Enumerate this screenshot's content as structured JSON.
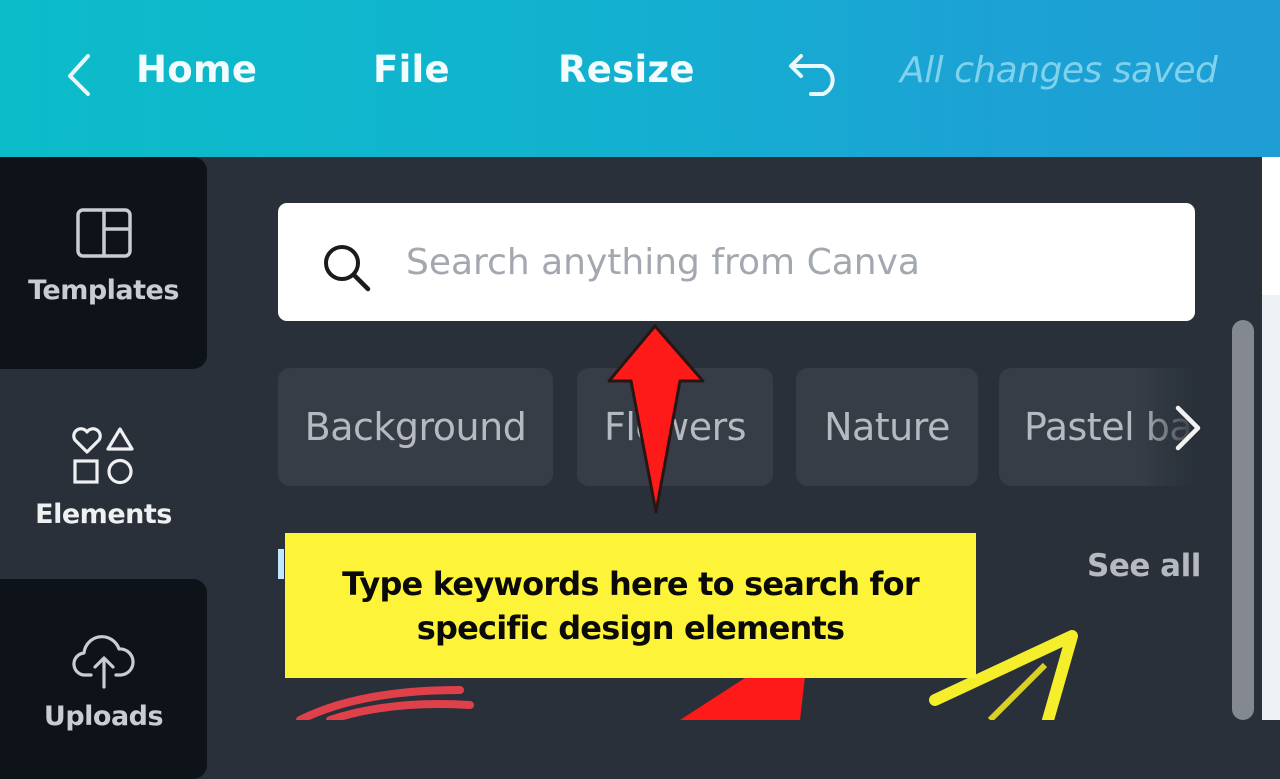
{
  "topbar": {
    "back_icon": "chevron-left-icon",
    "home_label": "Home",
    "file_label": "File",
    "resize_label": "Resize",
    "undo_icon": "undo-icon",
    "save_status": "All changes saved",
    "colors": {
      "gradient_start": "#0cbcc9",
      "gradient_end": "#1f9dd5"
    }
  },
  "sidebar": {
    "items": [
      {
        "label": "Templates",
        "icon": "templates-layout-icon",
        "active": false
      },
      {
        "label": "Elements",
        "icon": "shapes-icon",
        "active": true
      },
      {
        "label": "Uploads",
        "icon": "cloud-upload-icon",
        "active": false
      }
    ]
  },
  "panel": {
    "search": {
      "placeholder": "Search anything from Canva",
      "value": "",
      "icon": "search-icon"
    },
    "suggestion_chips": [
      {
        "label": "Background"
      },
      {
        "label": "Flowers"
      },
      {
        "label": "Nature"
      },
      {
        "label": "Pastel ba"
      }
    ],
    "chips_next_icon": "chevron-right-icon",
    "see_all_label": "See all"
  },
  "annotation": {
    "callout_text": "Type keywords here to search for specific design elements",
    "arrow_color": "#ff1a1a",
    "callout_color": "#fdf43a"
  }
}
